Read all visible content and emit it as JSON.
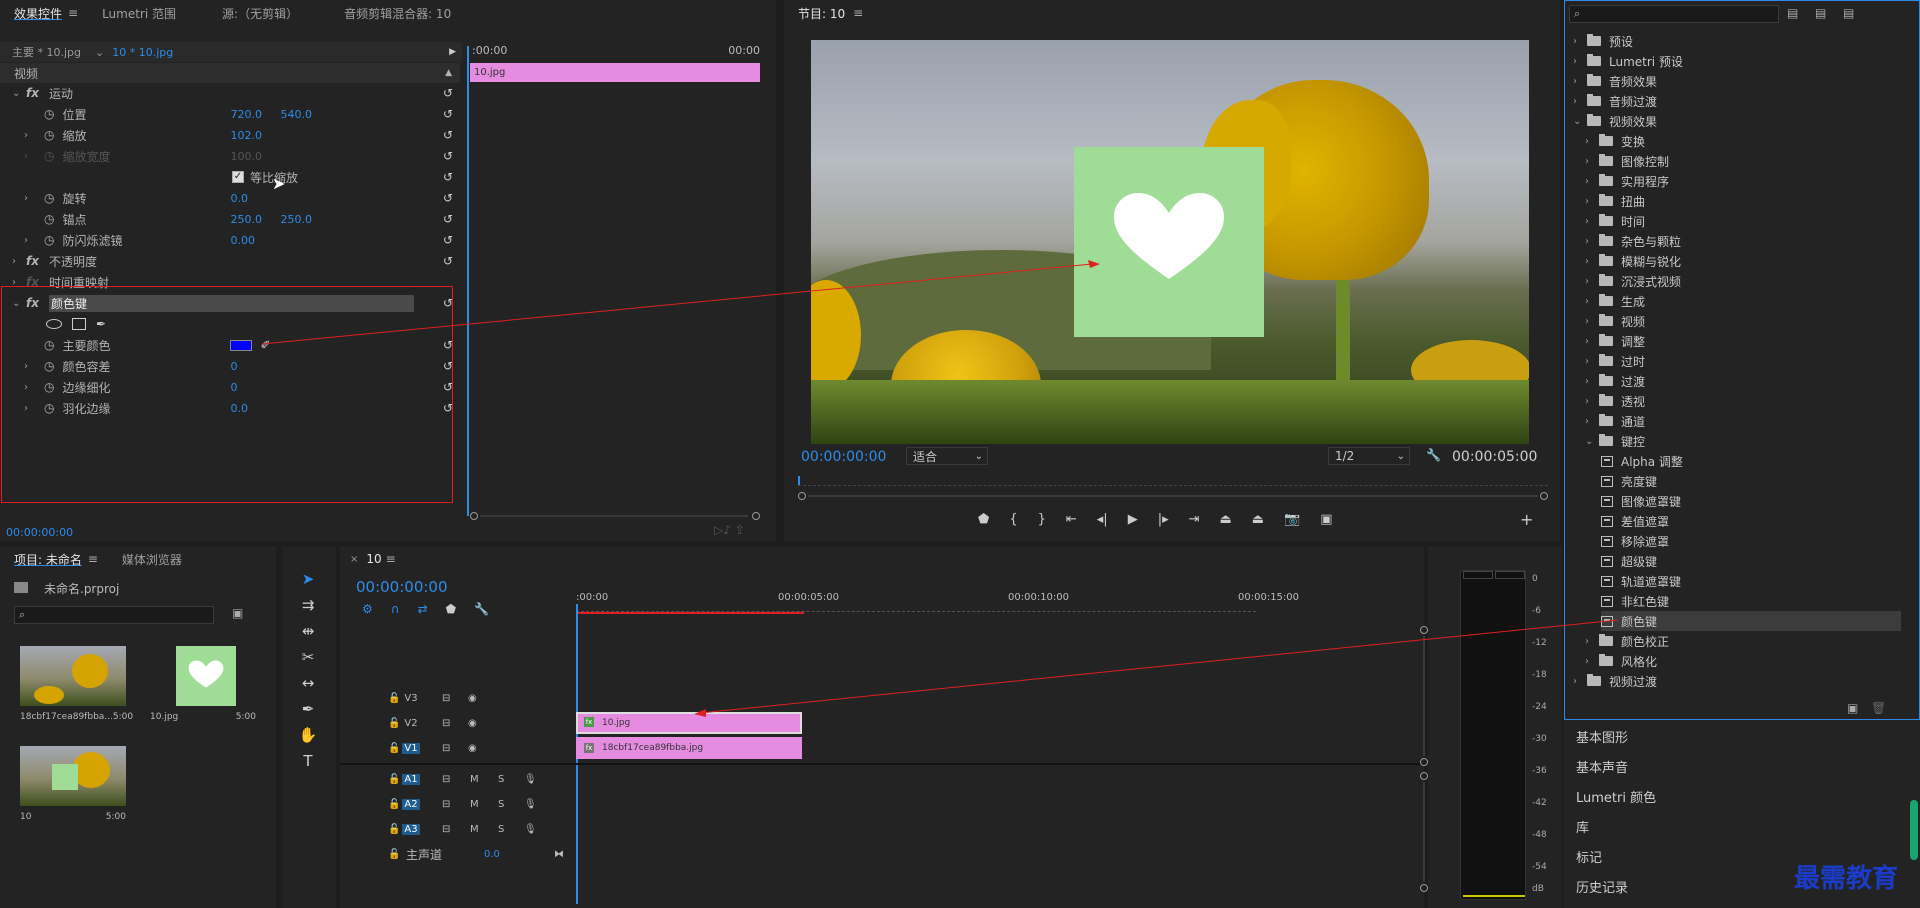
{
  "effect_controls": {
    "tabs": [
      "效果控件",
      "Lumetri 范围",
      "源:（无剪辑）",
      "音频剪辑混合器: 10"
    ],
    "source_label": "主要 * 10.jpg",
    "clip_label": "10 * 10.jpg",
    "ruler_start": ":00:00",
    "ruler_end": "00:00",
    "clip_bar_label": "10.jpg",
    "section_video": "视频",
    "motion": "运动",
    "position_label": "位置",
    "position_x": "720.0",
    "position_y": "540.0",
    "scale_label": "缩放",
    "scale_value": "102.0",
    "scale_width_label": "缩放宽度",
    "scale_width_value": "100.0",
    "uniform_scale_label": "等比缩放",
    "rotation_label": "旋转",
    "rotation_value": "0.0",
    "anchor_label": "锚点",
    "anchor_x": "250.0",
    "anchor_y": "250.0",
    "antiflicker_label": "防闪烁滤镜",
    "antiflicker_value": "0.00",
    "opacity": "不透明度",
    "time_remap": "时间重映射",
    "color_key": "颜色键",
    "key_color_label": "主要颜色",
    "key_color": "#0000ff",
    "tolerance_label": "颜色容差",
    "tolerance_value": "0",
    "edge_thin_label": "边缘细化",
    "edge_thin_value": "0",
    "feather_label": "羽化边缘",
    "feather_value": "0.0",
    "timecode": "00:00:00:00"
  },
  "program": {
    "title": "节目: 10",
    "timecode": "00:00:00:00",
    "fit": "适合",
    "resolution": "1/2",
    "duration": "00:00:05:00"
  },
  "project": {
    "tabs": [
      "项目: 未命名",
      "媒体浏览器"
    ],
    "filename": "未命名.prproj",
    "items": [
      {
        "name": "18cbf17cea89fbba...",
        "dur": "5:00"
      },
      {
        "name": "10.jpg",
        "dur": "5:00"
      },
      {
        "name": "10",
        "dur": "5:00"
      }
    ]
  },
  "timeline": {
    "tab": "10",
    "timecode": "00:00:00:00",
    "ruler": [
      ":00:00",
      "00:00:05:00",
      "00:00:10:00",
      "00:00:15:00"
    ],
    "tracks_video": [
      "V3",
      "V2",
      "V1"
    ],
    "tracks_audio": [
      "A1",
      "A2",
      "A3"
    ],
    "master": "主声道",
    "master_value": "0.0",
    "clip_v2": "10.jpg",
    "clip_v1": "18cbf17cea89fbba.jpg",
    "m": "M",
    "s": "S"
  },
  "meter": {
    "scale": [
      "0",
      "-6",
      "-12",
      "-18",
      "-24",
      "-30",
      "-36",
      "-42",
      "-48",
      "-54",
      "dB"
    ]
  },
  "effects_panel": {
    "tree": [
      {
        "label": "预设",
        "level": 0,
        "icon": "folder",
        "chev": "›"
      },
      {
        "label": "Lumetri 预设",
        "level": 0,
        "icon": "folder",
        "chev": "›"
      },
      {
        "label": "音频效果",
        "level": 0,
        "icon": "folder",
        "chev": "›"
      },
      {
        "label": "音频过渡",
        "level": 0,
        "icon": "folder",
        "chev": "›"
      },
      {
        "label": "视频效果",
        "level": 0,
        "icon": "folder",
        "chev": "⌄"
      },
      {
        "label": "变换",
        "level": 1,
        "icon": "folder",
        "chev": "›"
      },
      {
        "label": "图像控制",
        "level": 1,
        "icon": "folder",
        "chev": "›"
      },
      {
        "label": "实用程序",
        "level": 1,
        "icon": "folder",
        "chev": "›"
      },
      {
        "label": "扭曲",
        "level": 1,
        "icon": "folder",
        "chev": "›"
      },
      {
        "label": "时间",
        "level": 1,
        "icon": "folder",
        "chev": "›"
      },
      {
        "label": "杂色与颗粒",
        "level": 1,
        "icon": "folder",
        "chev": "›"
      },
      {
        "label": "模糊与锐化",
        "level": 1,
        "icon": "folder",
        "chev": "›"
      },
      {
        "label": "沉浸式视频",
        "level": 1,
        "icon": "folder",
        "chev": "›"
      },
      {
        "label": "生成",
        "level": 1,
        "icon": "folder",
        "chev": "›"
      },
      {
        "label": "视频",
        "level": 1,
        "icon": "folder",
        "chev": "›"
      },
      {
        "label": "调整",
        "level": 1,
        "icon": "folder",
        "chev": "›"
      },
      {
        "label": "过时",
        "level": 1,
        "icon": "folder",
        "chev": "›"
      },
      {
        "label": "过渡",
        "level": 1,
        "icon": "folder",
        "chev": "›"
      },
      {
        "label": "透视",
        "level": 1,
        "icon": "folder",
        "chev": "›"
      },
      {
        "label": "通道",
        "level": 1,
        "icon": "folder",
        "chev": "›"
      },
      {
        "label": "键控",
        "level": 1,
        "icon": "folder",
        "chev": "⌄"
      },
      {
        "label": "Alpha 调整",
        "level": 2,
        "icon": "fx",
        "chev": ""
      },
      {
        "label": "亮度键",
        "level": 2,
        "icon": "fx",
        "chev": ""
      },
      {
        "label": "图像遮罩键",
        "level": 2,
        "icon": "fx",
        "chev": ""
      },
      {
        "label": "差值遮罩",
        "level": 2,
        "icon": "fx",
        "chev": ""
      },
      {
        "label": "移除遮罩",
        "level": 2,
        "icon": "fx",
        "chev": ""
      },
      {
        "label": "超级键",
        "level": 2,
        "icon": "fx",
        "chev": ""
      },
      {
        "label": "轨道遮罩键",
        "level": 2,
        "icon": "fx",
        "chev": ""
      },
      {
        "label": "非红色键",
        "level": 2,
        "icon": "fx",
        "chev": ""
      },
      {
        "label": "颜色键",
        "level": 2,
        "icon": "fx",
        "chev": "",
        "selected": true
      },
      {
        "label": "颜色校正",
        "level": 1,
        "icon": "folder",
        "chev": "›"
      },
      {
        "label": "风格化",
        "level": 1,
        "icon": "folder",
        "chev": "›"
      },
      {
        "label": "视频过渡",
        "level": 0,
        "icon": "folder",
        "chev": "›"
      }
    ],
    "panels": [
      "基本图形",
      "基本声音",
      "Lumetri 颜色",
      "库",
      "标记",
      "历史记录"
    ]
  },
  "watermark": "最需教育",
  "colors": {
    "accent": "#2d8ceb",
    "clip": "#e58be0",
    "heart_bg": "#9fdc95",
    "annotation": "#e02020"
  }
}
